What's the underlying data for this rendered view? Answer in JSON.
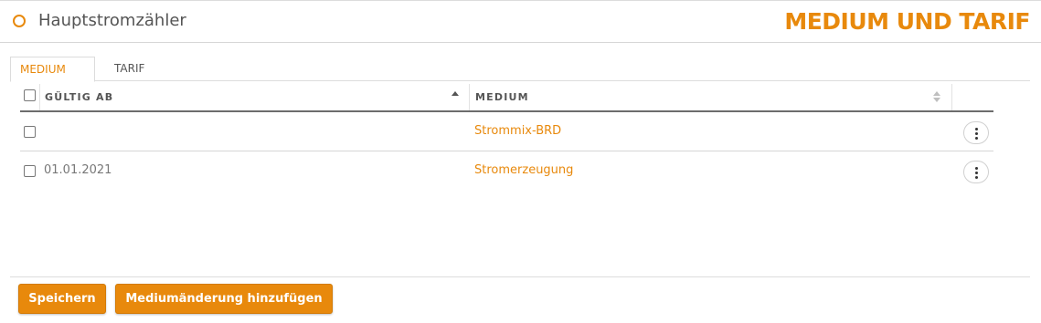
{
  "header": {
    "title": "Hauptstromzähler",
    "section_title": "MEDIUM UND TARIF"
  },
  "tabs": [
    {
      "label": "MEDIUM",
      "active": true
    },
    {
      "label": "TARIF",
      "active": false
    }
  ],
  "table": {
    "columns": [
      {
        "label": "GÜLTIG AB",
        "sort": "ascending"
      },
      {
        "label": "MEDIUM",
        "sort": "none"
      }
    ],
    "rows": [
      {
        "valid_from": "",
        "medium": "Strommix-BRD"
      },
      {
        "valid_from": "01.01.2021",
        "medium": "Stromerzeugung"
      }
    ]
  },
  "footer": {
    "save_label": "Speichern",
    "add_label": "Mediumänderung hinzufügen"
  },
  "colors": {
    "accent": "#e8890c",
    "text": "#555555"
  }
}
